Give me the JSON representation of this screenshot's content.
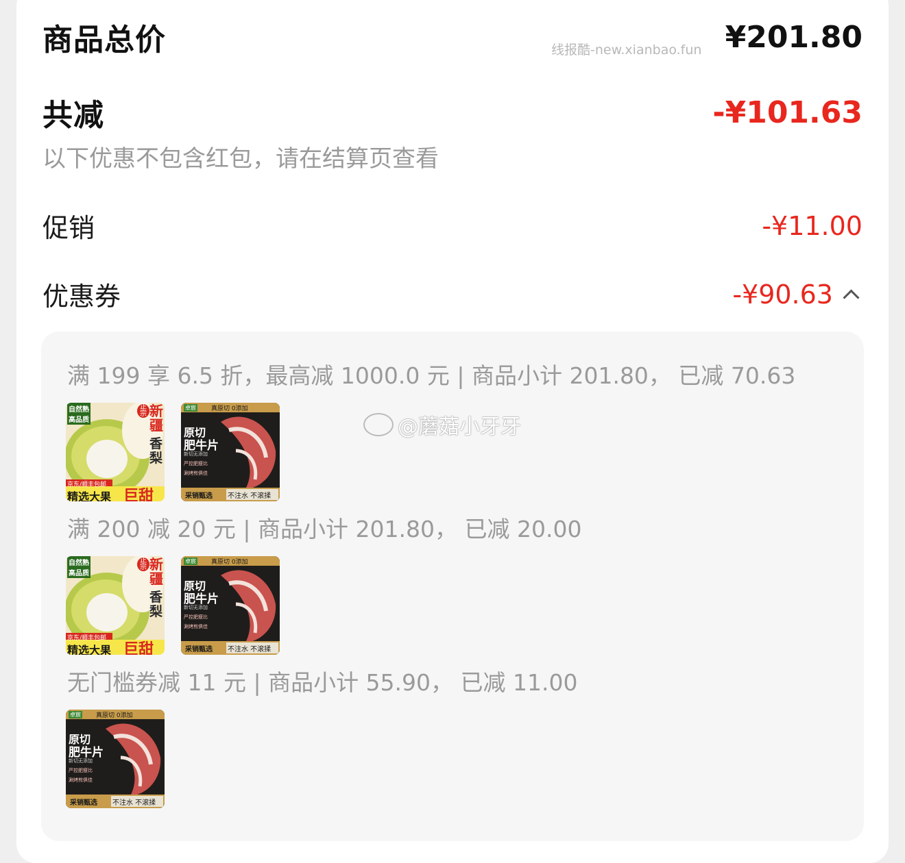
{
  "summary": {
    "total_label": "商品总价",
    "total_value": "¥201.80",
    "reduce_label": "共减",
    "reduce_value": "-¥101.63",
    "note": "以下优惠不包含红包，请在结算页查看",
    "promo_label": "促销",
    "promo_value": "-¥11.00",
    "coupon_label": "优惠券",
    "coupon_value": "-¥90.63"
  },
  "watermarks": {
    "site": "线报酷-new.xianbao.fun",
    "weibo": "@蘑菇小牙牙"
  },
  "coupons": [
    {
      "text": "满 199 享 6.5 折，最高减 1000.0 元 | 商品小计 201.80， 已减 70.63"
    },
    {
      "text": "满 200 减 20 元 | 商品小计 201.80， 已减 20.00"
    },
    {
      "text": "无门槛券减 11 元 | 商品小计 55.90， 已减 11.00"
    }
  ],
  "products": {
    "pear": {
      "badge_top": "自然熟",
      "badge_sub": "高品质",
      "tag": "正宗",
      "name_1": "新疆",
      "name_2": "香梨",
      "ship": "京东/顺丰包邮",
      "slogan_1": "精选大果",
      "slogan_2": "巨甜"
    },
    "beef": {
      "brand": "卓宸",
      "top": "真原切 0添加",
      "name_1": "原切",
      "name_2": "肥牛片",
      "f1": "新切无添加",
      "f2": "严控肥瘦比",
      "f3": "涮烤煎俱佳",
      "b1": "采销甄选",
      "b2": "不注水 不滚揉"
    }
  },
  "colors": {
    "accent_red": "#e8271e",
    "muted": "#9a9a9a"
  }
}
